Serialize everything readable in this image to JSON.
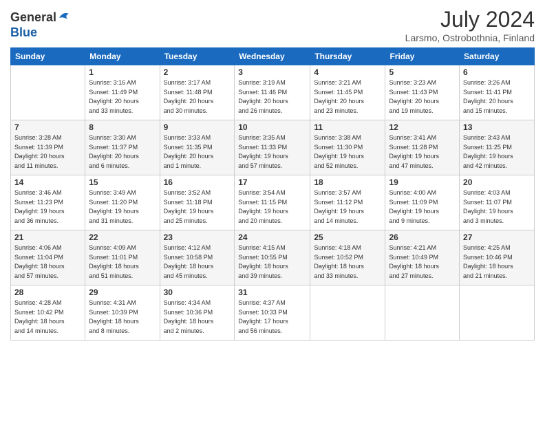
{
  "header": {
    "logo_general": "General",
    "logo_blue": "Blue",
    "month_title": "July 2024",
    "subtitle": "Larsmo, Ostrobothnia, Finland"
  },
  "weekdays": [
    "Sunday",
    "Monday",
    "Tuesday",
    "Wednesday",
    "Thursday",
    "Friday",
    "Saturday"
  ],
  "weeks": [
    [
      {
        "day": "",
        "info": ""
      },
      {
        "day": "1",
        "info": "Sunrise: 3:16 AM\nSunset: 11:49 PM\nDaylight: 20 hours\nand 33 minutes."
      },
      {
        "day": "2",
        "info": "Sunrise: 3:17 AM\nSunset: 11:48 PM\nDaylight: 20 hours\nand 30 minutes."
      },
      {
        "day": "3",
        "info": "Sunrise: 3:19 AM\nSunset: 11:46 PM\nDaylight: 20 hours\nand 26 minutes."
      },
      {
        "day": "4",
        "info": "Sunrise: 3:21 AM\nSunset: 11:45 PM\nDaylight: 20 hours\nand 23 minutes."
      },
      {
        "day": "5",
        "info": "Sunrise: 3:23 AM\nSunset: 11:43 PM\nDaylight: 20 hours\nand 19 minutes."
      },
      {
        "day": "6",
        "info": "Sunrise: 3:26 AM\nSunset: 11:41 PM\nDaylight: 20 hours\nand 15 minutes."
      }
    ],
    [
      {
        "day": "7",
        "info": "Sunrise: 3:28 AM\nSunset: 11:39 PM\nDaylight: 20 hours\nand 11 minutes."
      },
      {
        "day": "8",
        "info": "Sunrise: 3:30 AM\nSunset: 11:37 PM\nDaylight: 20 hours\nand 6 minutes."
      },
      {
        "day": "9",
        "info": "Sunrise: 3:33 AM\nSunset: 11:35 PM\nDaylight: 20 hours\nand 1 minute."
      },
      {
        "day": "10",
        "info": "Sunrise: 3:35 AM\nSunset: 11:33 PM\nDaylight: 19 hours\nand 57 minutes."
      },
      {
        "day": "11",
        "info": "Sunrise: 3:38 AM\nSunset: 11:30 PM\nDaylight: 19 hours\nand 52 minutes."
      },
      {
        "day": "12",
        "info": "Sunrise: 3:41 AM\nSunset: 11:28 PM\nDaylight: 19 hours\nand 47 minutes."
      },
      {
        "day": "13",
        "info": "Sunrise: 3:43 AM\nSunset: 11:25 PM\nDaylight: 19 hours\nand 42 minutes."
      }
    ],
    [
      {
        "day": "14",
        "info": "Sunrise: 3:46 AM\nSunset: 11:23 PM\nDaylight: 19 hours\nand 36 minutes."
      },
      {
        "day": "15",
        "info": "Sunrise: 3:49 AM\nSunset: 11:20 PM\nDaylight: 19 hours\nand 31 minutes."
      },
      {
        "day": "16",
        "info": "Sunrise: 3:52 AM\nSunset: 11:18 PM\nDaylight: 19 hours\nand 25 minutes."
      },
      {
        "day": "17",
        "info": "Sunrise: 3:54 AM\nSunset: 11:15 PM\nDaylight: 19 hours\nand 20 minutes."
      },
      {
        "day": "18",
        "info": "Sunrise: 3:57 AM\nSunset: 11:12 PM\nDaylight: 19 hours\nand 14 minutes."
      },
      {
        "day": "19",
        "info": "Sunrise: 4:00 AM\nSunset: 11:09 PM\nDaylight: 19 hours\nand 9 minutes."
      },
      {
        "day": "20",
        "info": "Sunrise: 4:03 AM\nSunset: 11:07 PM\nDaylight: 19 hours\nand 3 minutes."
      }
    ],
    [
      {
        "day": "21",
        "info": "Sunrise: 4:06 AM\nSunset: 11:04 PM\nDaylight: 18 hours\nand 57 minutes."
      },
      {
        "day": "22",
        "info": "Sunrise: 4:09 AM\nSunset: 11:01 PM\nDaylight: 18 hours\nand 51 minutes."
      },
      {
        "day": "23",
        "info": "Sunrise: 4:12 AM\nSunset: 10:58 PM\nDaylight: 18 hours\nand 45 minutes."
      },
      {
        "day": "24",
        "info": "Sunrise: 4:15 AM\nSunset: 10:55 PM\nDaylight: 18 hours\nand 39 minutes."
      },
      {
        "day": "25",
        "info": "Sunrise: 4:18 AM\nSunset: 10:52 PM\nDaylight: 18 hours\nand 33 minutes."
      },
      {
        "day": "26",
        "info": "Sunrise: 4:21 AM\nSunset: 10:49 PM\nDaylight: 18 hours\nand 27 minutes."
      },
      {
        "day": "27",
        "info": "Sunrise: 4:25 AM\nSunset: 10:46 PM\nDaylight: 18 hours\nand 21 minutes."
      }
    ],
    [
      {
        "day": "28",
        "info": "Sunrise: 4:28 AM\nSunset: 10:42 PM\nDaylight: 18 hours\nand 14 minutes."
      },
      {
        "day": "29",
        "info": "Sunrise: 4:31 AM\nSunset: 10:39 PM\nDaylight: 18 hours\nand 8 minutes."
      },
      {
        "day": "30",
        "info": "Sunrise: 4:34 AM\nSunset: 10:36 PM\nDaylight: 18 hours\nand 2 minutes."
      },
      {
        "day": "31",
        "info": "Sunrise: 4:37 AM\nSunset: 10:33 PM\nDaylight: 17 hours\nand 56 minutes."
      },
      {
        "day": "",
        "info": ""
      },
      {
        "day": "",
        "info": ""
      },
      {
        "day": "",
        "info": ""
      }
    ]
  ]
}
